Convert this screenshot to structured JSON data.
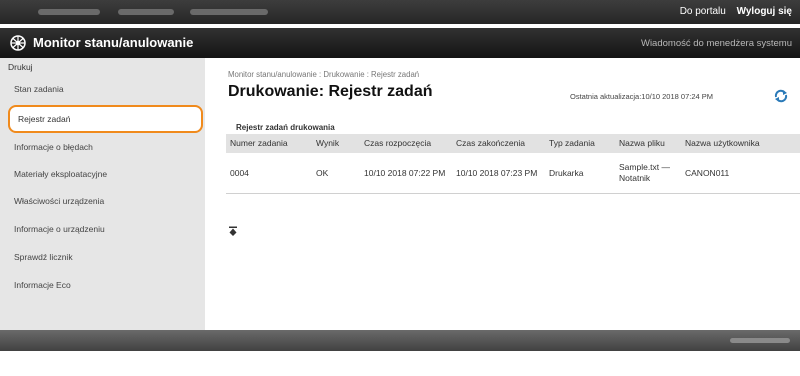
{
  "top_links": {
    "portal": "Do portalu",
    "logout": "Wyloguj się"
  },
  "app": {
    "title": "Monitor stanu/anulowanie",
    "admin_message": "Wiadomość do menedżera systemu"
  },
  "sidebar": {
    "group": "Drukuj",
    "items": [
      {
        "label": "Stan zadania"
      },
      {
        "label": "Rejestr zadań",
        "selected": true
      },
      {
        "label": "Informacje o błędach"
      },
      {
        "label": "Materiały eksploatacyjne"
      },
      {
        "label": "Właściwości urządzenia"
      },
      {
        "label": "Informacje o urządzeniu"
      },
      {
        "label": "Sprawdź licznik"
      },
      {
        "label": "Informacje Eco"
      }
    ]
  },
  "breadcrumb": {
    "part1": "Monitor stanu/anulowanie",
    "part2": "Drukowanie",
    "part3": "Rejestr zadań",
    "separator": " : "
  },
  "page_title": "Drukowanie: Rejestr zadań",
  "last_update": "Ostatnia aktualizacja:10/10 2018 07:24 PM",
  "section_title": "Rejestr zadań drukowania",
  "table": {
    "headers": [
      "Numer zadania",
      "Wynik",
      "Czas rozpoczęcia",
      "Czas zakończenia",
      "Typ zadania",
      "Nazwa pliku",
      "Nazwa użytkownika"
    ],
    "rows": [
      {
        "number": "0004",
        "result": "OK",
        "start": "10/10 2018 07:22 PM",
        "end": "10/10 2018 07:23 PM",
        "type": "Drukarka",
        "file": "Sample.txt — Notatnik",
        "user": "CANON011"
      }
    ]
  },
  "colors": {
    "selection_border": "#f08a1c",
    "header_bar": "#1a1a1a",
    "sidebar_bg": "#e6e6e6",
    "refresh_icon": "#2a7ab8"
  },
  "icons": {
    "logo": "canon-globe-icon",
    "refresh": "refresh-icon",
    "scroll_top": "go-to-top-icon"
  }
}
